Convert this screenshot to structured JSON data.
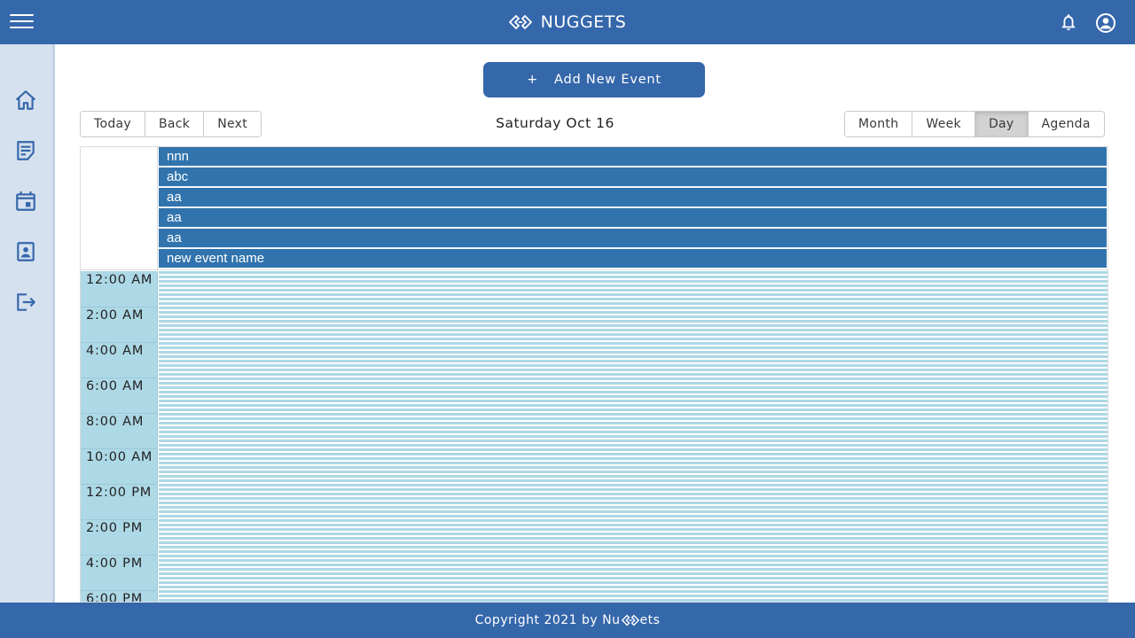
{
  "app": {
    "title": "NUGGETS"
  },
  "actions": {
    "add_event_label": "Add New Event",
    "add_event_icon": "+"
  },
  "nav_buttons": [
    "Today",
    "Back",
    "Next"
  ],
  "current_date": "Saturday Oct 16",
  "view_buttons": [
    {
      "label": "Month",
      "active": false
    },
    {
      "label": "Week",
      "active": false
    },
    {
      "label": "Day",
      "active": true
    },
    {
      "label": "Agenda",
      "active": false
    }
  ],
  "all_day_events": [
    "nnn",
    "abc",
    "aa",
    "aa",
    "aa",
    "new event name"
  ],
  "time_slots": [
    "12:00 AM",
    "2:00 AM",
    "4:00 AM",
    "6:00 AM",
    "8:00 AM",
    "10:00 AM",
    "12:00 PM",
    "2:00 PM",
    "4:00 PM",
    "6:00 PM"
  ],
  "sidebar": {
    "items": [
      {
        "icon": "home-icon"
      },
      {
        "icon": "note-icon"
      },
      {
        "icon": "calendar-icon"
      },
      {
        "icon": "contact-icon"
      },
      {
        "icon": "logout-icon"
      }
    ]
  },
  "footer": {
    "text_before": "Copyright 2021 by Nu",
    "text_after": "ets"
  },
  "colors": {
    "primary": "#3567ab",
    "event": "#3174ad",
    "slot": "#add8e6",
    "sidebar": "#d6e1ef"
  }
}
